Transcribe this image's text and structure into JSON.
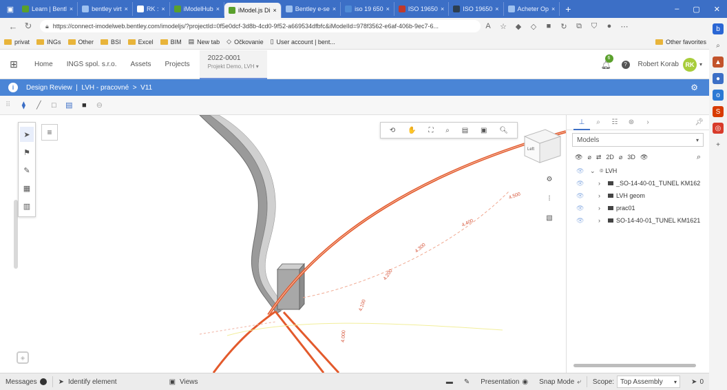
{
  "browser": {
    "tabs": [
      {
        "label": "Learn | Bentl",
        "color": "#5aa02c"
      },
      {
        "label": "bentley virt",
        "color": "#3c6fc6"
      },
      {
        "label": "RK :",
        "color": "#ffffff"
      },
      {
        "label": "iModelHub",
        "color": "#5aa02c"
      },
      {
        "label": "iModel.js Di",
        "color": "#5aa02c",
        "active": true
      },
      {
        "label": "Bentley e-se",
        "color": "#3c6fc6"
      },
      {
        "label": "iso 19 650",
        "color": "#4f8bd6"
      },
      {
        "label": "ISO 19650",
        "color": "#c0392b"
      },
      {
        "label": "ISO 19650",
        "color": "#2c3e50"
      },
      {
        "label": "Acheter Op",
        "color": "#3c6fc6"
      }
    ],
    "url": "https://connect-imodelweb.bentley.com/imodeljs/?projectId=0f5e0dcf-3d8b-4cd0-9f52-a669534dfbfc&iModelId=978f3562-e6af-406b-9ec7-6...",
    "bookmarks": [
      "privat",
      "INGs",
      "Other",
      "BSI",
      "Excel",
      "BIM",
      "New tab",
      "Očkovanie",
      "User account | bent..."
    ],
    "other_favorites": "Other favorites"
  },
  "header": {
    "nav": [
      "Home",
      "INGS spol. s.r.o.",
      "Assets",
      "Projects"
    ],
    "project_id": "2022-0001",
    "project_name": "Projekt Demo, LVH",
    "notifications": "6",
    "user_name": "Robert Korab",
    "user_initials": "RK"
  },
  "breadcrumb": {
    "text": "Design Review  |  LVH - pracovné  >  V11"
  },
  "viewcube": {
    "label": "Left"
  },
  "panel": {
    "models_label": "Models",
    "visibility_2d": "2D",
    "visibility_3d": "3D",
    "tree": [
      {
        "label": "LVH",
        "level": 0
      },
      {
        "label": "_SO-14-40-01_TUNEL KM162",
        "level": 1
      },
      {
        "label": "LVH geom",
        "level": 1
      },
      {
        "label": "prac01",
        "level": 1
      },
      {
        "label": "SO-14-40-01_TUNEL KM1621",
        "level": 1
      }
    ]
  },
  "statusbar": {
    "messages": "Messages",
    "identify": "Identify element",
    "views": "Views",
    "presentation": "Presentation",
    "snap_mode": "Snap Mode",
    "scope_label": "Scope:",
    "scope_value": "Top Assembly",
    "selection_count": "0"
  },
  "stations": [
    "4.500",
    "4.400",
    "4.300",
    "4.200",
    "4.100",
    "4.000"
  ],
  "colors": {
    "accent": "#4a85d6",
    "tab_bar": "#3c6fc6",
    "track": "#e35a2c",
    "avatar": "#a8cd3b"
  }
}
